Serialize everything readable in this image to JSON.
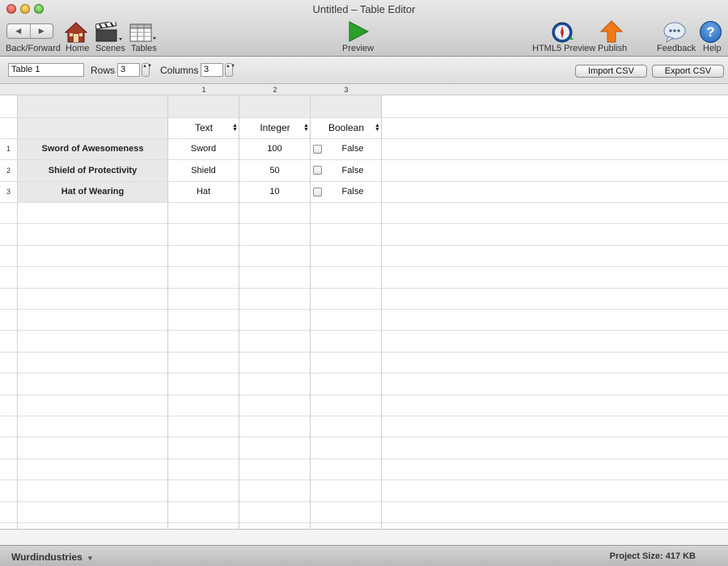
{
  "window": {
    "title": "Untitled – Table Editor"
  },
  "toolbar": {
    "back_forward_label": "Back/Forward",
    "back_arrow": "◀",
    "forward_arrow": "▶",
    "home_label": "Home",
    "scenes_label": "Scenes",
    "tables_label": "Tables",
    "preview_label": "Preview",
    "html5_preview_label": "HTML5 Preview",
    "publish_label": "Publish",
    "feedback_label": "Feedback",
    "help_label": "Help",
    "help_glyph": "?"
  },
  "table_options": {
    "table_name": "Table 1",
    "rows_label": "Rows",
    "rows_value": "3",
    "columns_label": "Columns",
    "columns_value": "3",
    "import_label": "Import CSV",
    "export_label": "Export CSV",
    "stepper_glyph": "▲▼"
  },
  "grid": {
    "column_numbers": [
      "1",
      "2",
      "3"
    ],
    "column_types": [
      "Text",
      "Integer",
      "Boolean"
    ],
    "rows": [
      {
        "num": "1",
        "name": "Sword of Awesomeness",
        "text": "Sword",
        "integer": "100",
        "boolean": "False"
      },
      {
        "num": "2",
        "name": "Shield of Protectivity",
        "text": "Shield",
        "integer": "50",
        "boolean": "False"
      },
      {
        "num": "3",
        "name": "Hat of Wearing",
        "text": "Hat",
        "integer": "10",
        "boolean": "False"
      }
    ]
  },
  "status": {
    "project_name": "Wurdindustries",
    "project_menu_glyph": "▾",
    "project_size": "Project Size: 417 KB"
  },
  "colors": {
    "accent_orange": "#f07a1a",
    "preview_green": "#2aa22a",
    "help_blue": "#1c63b8"
  }
}
